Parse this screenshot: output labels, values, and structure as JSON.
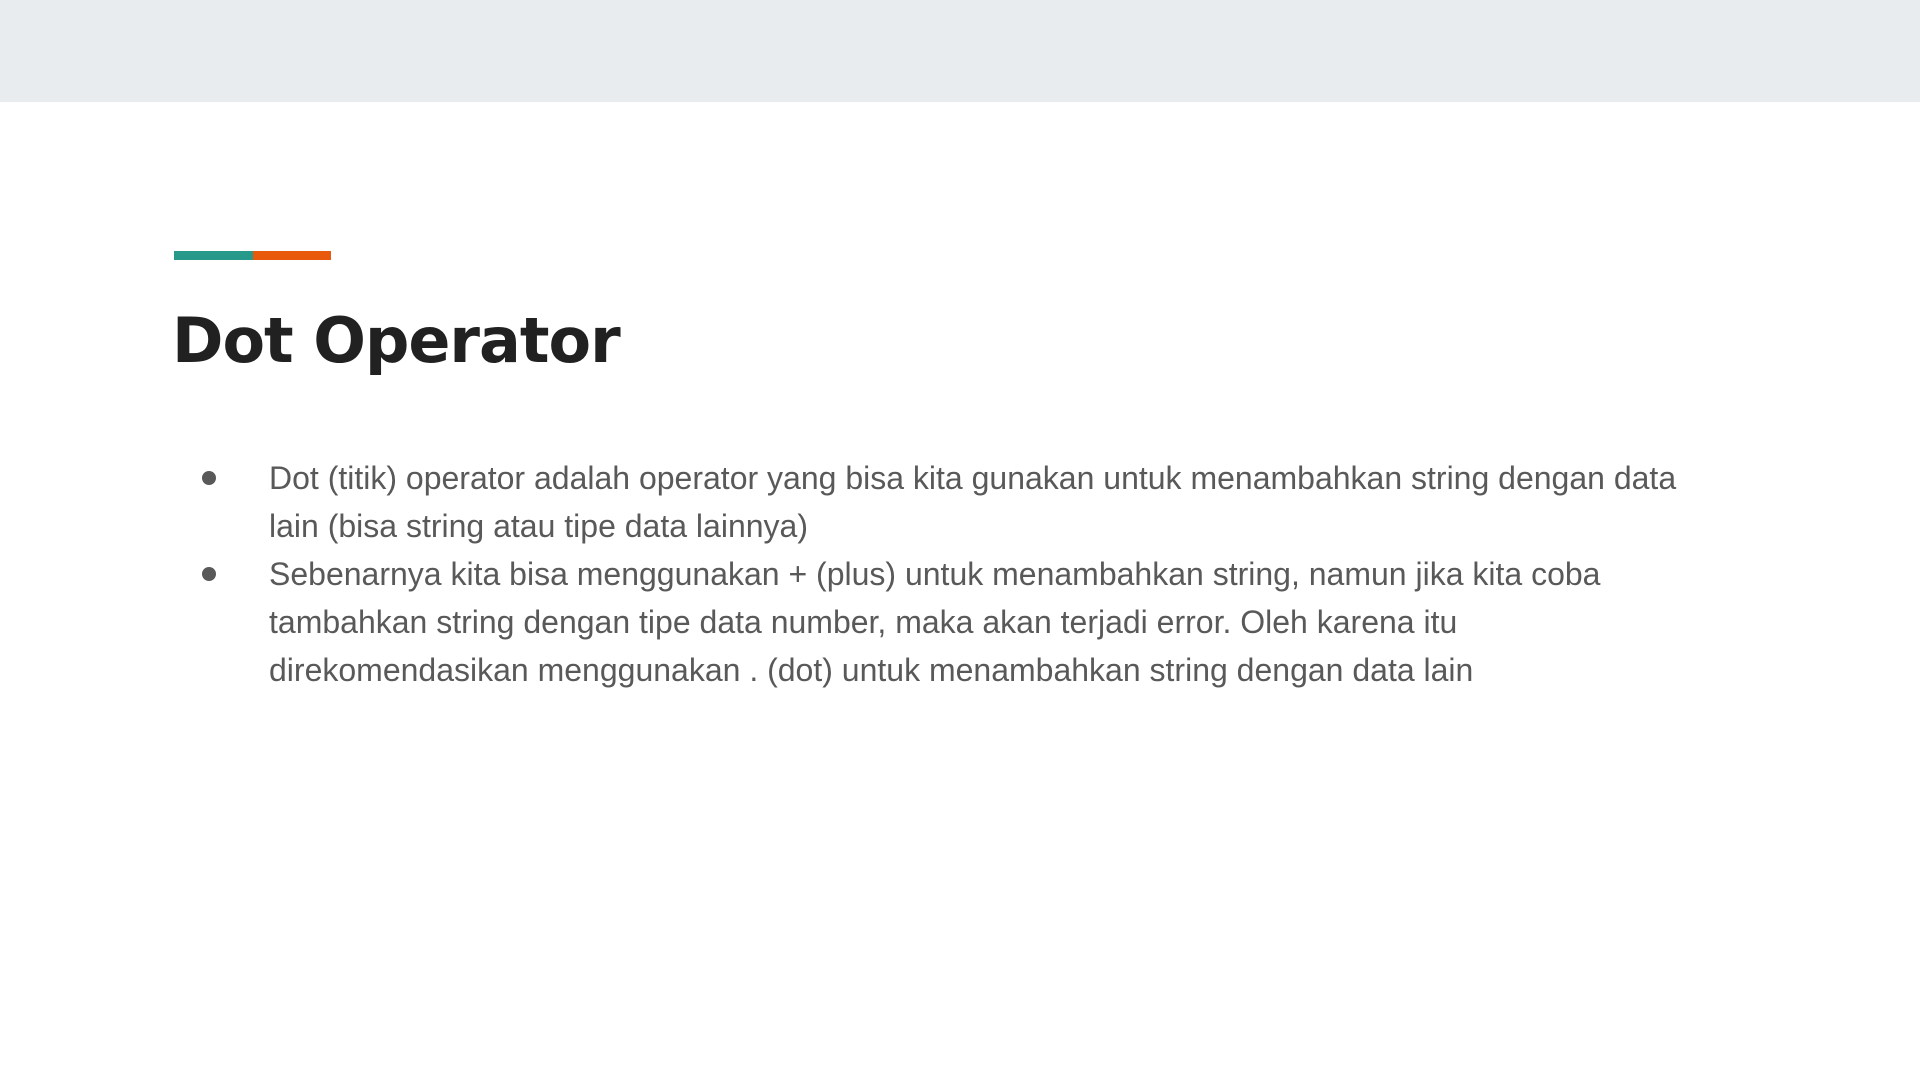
{
  "slide": {
    "title": "Dot Operator",
    "accent_colors": [
      "#26998a",
      "#e8590c"
    ],
    "bullets": [
      "Dot (titik) operator adalah operator yang bisa kita gunakan untuk menambahkan string dengan data lain (bisa string atau tipe data lainnya)",
      "Sebenarnya kita bisa menggunakan + (plus) untuk menambahkan string, namun jika kita coba tambahkan string dengan tipe data number, maka akan terjadi error. Oleh karena itu direkomendasikan menggunakan . (dot) untuk menambahkan string dengan data lain"
    ]
  }
}
